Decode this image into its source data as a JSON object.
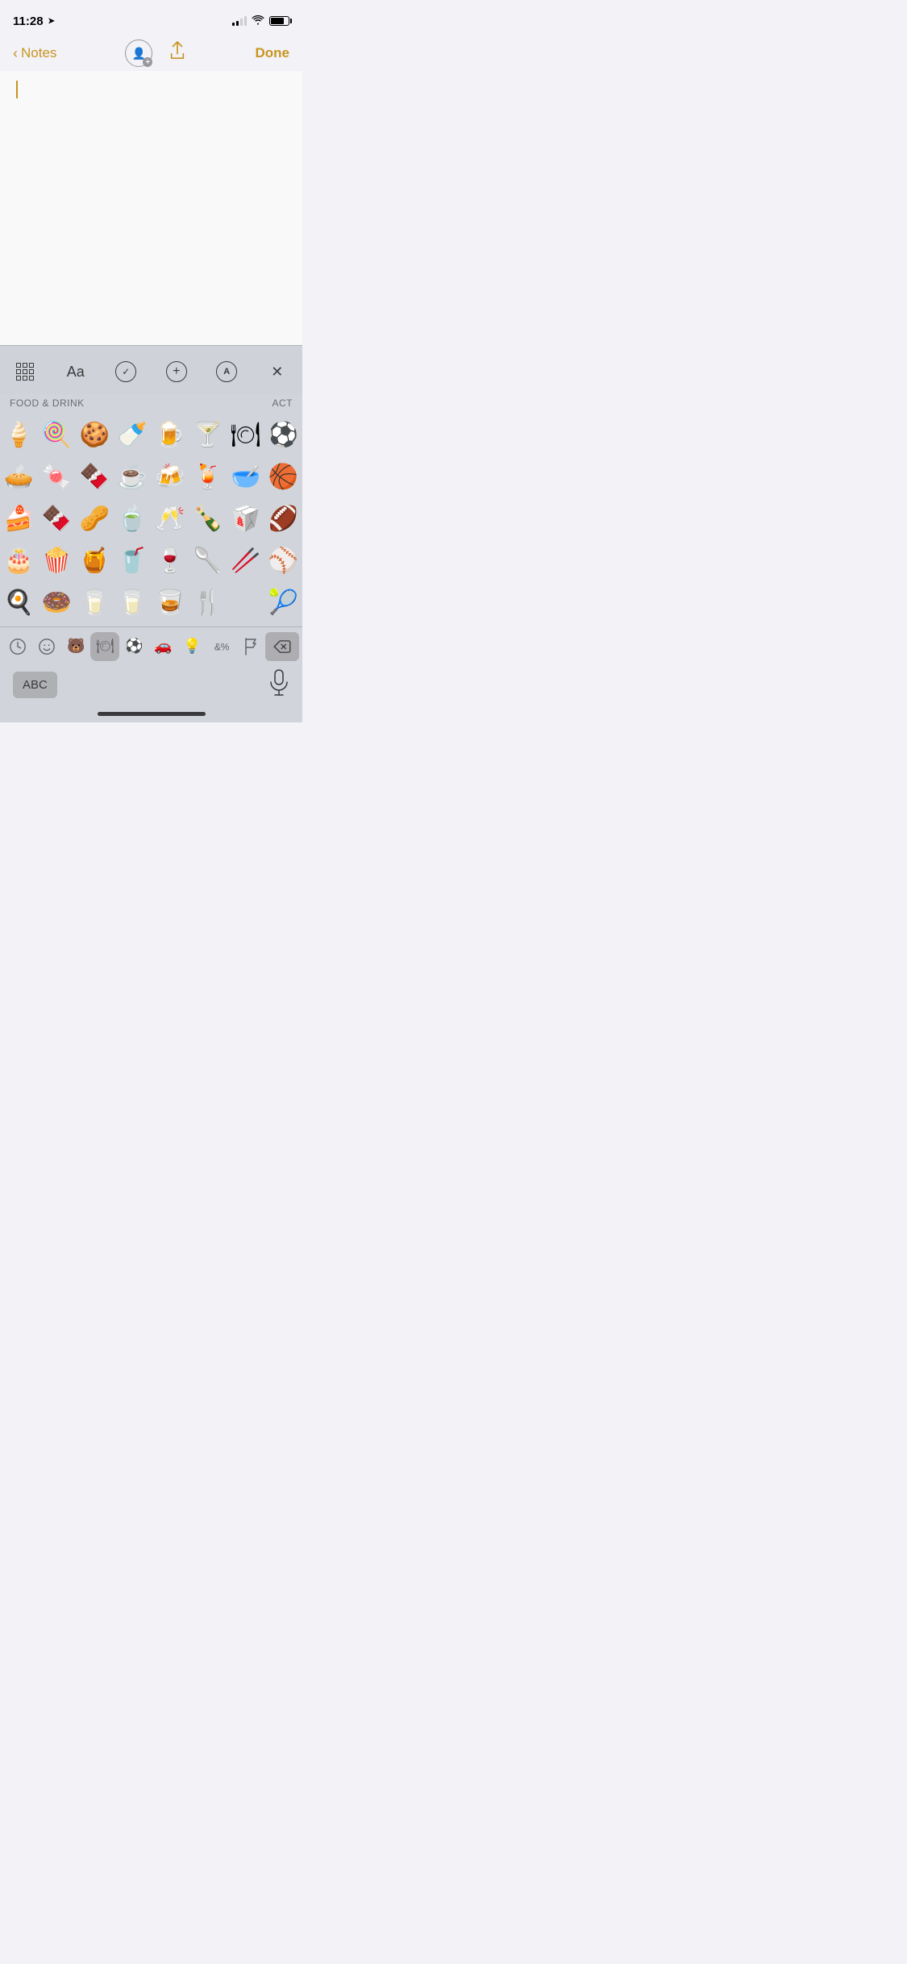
{
  "statusBar": {
    "time": "11:28",
    "locationArrow": "➤"
  },
  "navBar": {
    "backLabel": "Notes",
    "doneLabel": "Done"
  },
  "toolbar": {
    "gridLabel": "table",
    "aaLabel": "Aa",
    "checkLabel": "✓",
    "plusLabel": "+",
    "penLabel": "A",
    "closeLabel": "✕"
  },
  "emojiSection": {
    "categoryLeft": "FOOD & DRINK",
    "categoryRight": "ACT"
  },
  "emojiRows": [
    [
      "🍦",
      "🍭",
      "🍪",
      "🍼",
      "🍺",
      "🍸",
      "🍽",
      "⚽"
    ],
    [
      "🥧",
      "🍬",
      "🍫",
      "☕",
      "🍻",
      "🍹",
      "🥣",
      "🏀"
    ],
    [
      "🍰",
      "🍫",
      "🥜",
      "🍵",
      "🥂",
      "🍾",
      "🥡",
      "🏈"
    ],
    [
      "🎂",
      "🍿",
      "🍯",
      "🥤",
      "🍷",
      "🥄",
      "🥢",
      "⚾"
    ],
    [
      "🍳",
      "🍩",
      "🥛",
      "🥛",
      "🥃",
      "🍴",
      "  ",
      "🎾"
    ]
  ],
  "keyboardNav": {
    "clock": "🕐",
    "smiley": "☺",
    "bear": "🐻",
    "food": "🍽",
    "sports": "⚽",
    "car": "🚗",
    "bulb": "💡",
    "symbols": "&%",
    "flag": "🏳",
    "delete": "⌫"
  },
  "keyboardBottom": {
    "abc": "ABC",
    "mic": "🎙"
  }
}
